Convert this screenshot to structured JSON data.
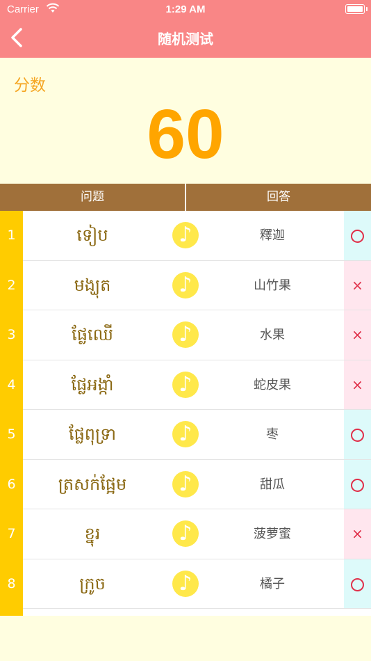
{
  "status_bar": {
    "carrier": "Carrier",
    "time": "1:29 AM"
  },
  "nav": {
    "title": "随机测试",
    "back_icon": "chevron-left-icon"
  },
  "score": {
    "label": "分数",
    "value": "60"
  },
  "table": {
    "headers": {
      "question": "问题",
      "answer": "回答"
    },
    "rows": [
      {
        "num": "1",
        "khmer": "ទៀប",
        "answer": "釋迦",
        "result": "correct",
        "result_symbol": ""
      },
      {
        "num": "2",
        "khmer": "មង្ឃុត",
        "answer": "山竹果",
        "result": "wrong",
        "result_symbol": "×"
      },
      {
        "num": "3",
        "khmer": "ផ្លែឈើ",
        "answer": "水果",
        "result": "wrong",
        "result_symbol": "×"
      },
      {
        "num": "4",
        "khmer": "ផ្លែអង្កាំ",
        "answer": "蛇皮果",
        "result": "wrong",
        "result_symbol": "×"
      },
      {
        "num": "5",
        "khmer": "ផ្លែពុទ្រា",
        "answer": "枣",
        "result": "correct",
        "result_symbol": ""
      },
      {
        "num": "6",
        "khmer": "ត្រសក់ផ្អែម",
        "answer": "甜瓜",
        "result": "correct",
        "result_symbol": ""
      },
      {
        "num": "7",
        "khmer": "ខ្នុរ",
        "answer": "菠萝蜜",
        "result": "wrong",
        "result_symbol": "×"
      },
      {
        "num": "8",
        "khmer": "ក្រូច",
        "answer": "橘子",
        "result": "correct",
        "result_symbol": ""
      }
    ]
  },
  "colors": {
    "nav_bg": "#F98686",
    "page_bg": "#FFFEE0",
    "header_bg": "#A0703A",
    "number_col": "#FFCC00",
    "score": "#FFA500",
    "khmer_text": "#8B6914",
    "audio_button": "#FFE84A",
    "correct_bg": "#DDFAFA",
    "wrong_bg": "#FFE6EE",
    "mark": "#E0304A"
  }
}
